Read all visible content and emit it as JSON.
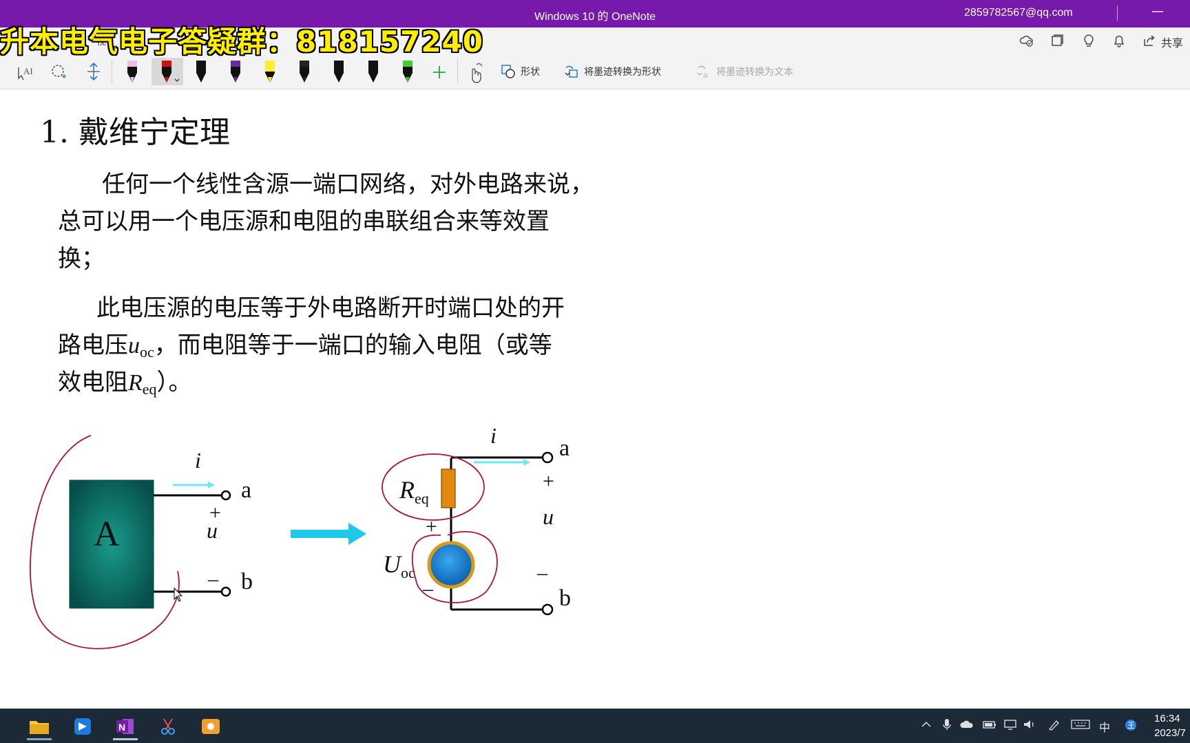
{
  "window": {
    "title": "Windows 10 的 OneNote",
    "account": "2859782567@qq.com",
    "minimize_glyph": "—"
  },
  "banner": {
    "text": "升本电气电子答疑群：818157240"
  },
  "ribbon": {
    "tab_hint": "视",
    "share_label": "共享",
    "shape_label": "形状",
    "ink_to_shape_label": "将墨迹转换为形状",
    "ink_to_text_label": "将墨迹转换为文本",
    "pen_colors": [
      "#e8c0e8",
      "#d01010",
      "#111111",
      "#6a2aa6",
      "#ffee33",
      "#222222",
      "#111111",
      "#111111",
      "#44cc33"
    ]
  },
  "content": {
    "heading": "1.  戴维宁定理",
    "p1_line1": "任何一个线性含源一端口网络，对外电路来说，",
    "p1_line2": "总可以用一个电压源和电阻的串联组合来等效置",
    "p1_line3": "换；",
    "p2_line1": "此电压源的电压等于外电路断开时端口处的开",
    "p2_line2_a": "路电压",
    "p2_u": "u",
    "p2_oc": "oc",
    "p2_line2_b": "，而电阻等于一端口的输入电阻（或等",
    "p2_line3_a": "效电阻",
    "p2_R": "R",
    "p2_eq": "eq",
    "p2_line3_b": "）。"
  },
  "diagram_left": {
    "block_label": "A",
    "current": "i",
    "node_a": "a",
    "node_b": "b",
    "plus": "+",
    "minus": "–",
    "voltage": "u"
  },
  "diagram_right": {
    "current": "i",
    "node_a": "a",
    "node_b": "b",
    "plus": "+",
    "minus": "–",
    "voltage": "u",
    "R": "R",
    "R_sub": "eq",
    "U": "U",
    "U_sub": "oc",
    "src_plus": "+",
    "src_minus": "–"
  },
  "taskbar": {
    "tray_ime": "中",
    "time": "16:34",
    "date": "2023/7"
  },
  "colors": {
    "titlebar": "#7719aa",
    "banner_text": "#ffee00",
    "block_fill": "#0c6b63",
    "ink_red": "#b0103a",
    "arrow_cyan": "#1ec8e8",
    "resistor": "#e08a10",
    "source_blue": "#1a86d8"
  }
}
